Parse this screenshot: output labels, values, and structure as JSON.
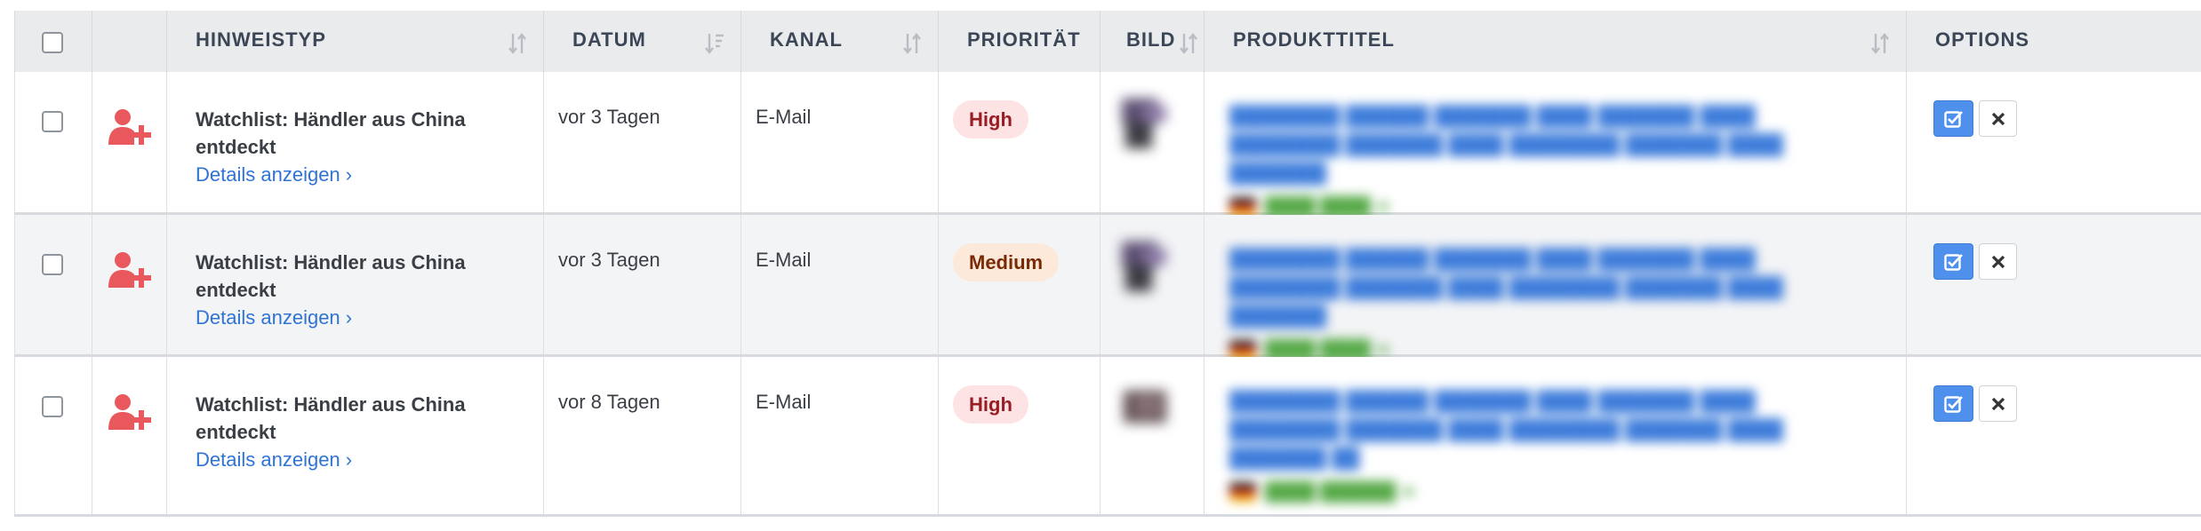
{
  "table": {
    "headers": {
      "type": "HINWEISTYP",
      "date": "DATUM",
      "channel": "KANAL",
      "priority": "PRIORITÄT",
      "image": "BILD",
      "title": "PRODUKTTITEL",
      "options": "OPTIONS"
    },
    "rows": [
      {
        "type": "Watchlist: Händler aus China entdeckt",
        "details": "Details anzeigen ›",
        "date": "vor 3 Tagen",
        "channel": "E-Mail",
        "priority": "High",
        "priority_level": "high",
        "product_title_redacted": "████████ ██████ ███████ ████ ███████ ████ ████████ ███████ ████ ████████ ███████ ████ ███████",
        "meta_redacted": "████ ████ ★"
      },
      {
        "type": "Watchlist: Händler aus China entdeckt",
        "details": "Details anzeigen ›",
        "date": "vor 3 Tagen",
        "channel": "E-Mail",
        "priority": "Medium",
        "priority_level": "medium",
        "product_title_redacted": "████████ ██████ ███████ ████ ███████ ████ ████████ ███████ ████ ████████ ███████ ████ ███████",
        "meta_redacted": "████ ████ ★"
      },
      {
        "type": "Watchlist: Händler aus China entdeckt",
        "details": "Details anzeigen ›",
        "date": "vor 8 Tagen",
        "channel": "E-Mail",
        "priority": "High",
        "priority_level": "high",
        "product_title_redacted": "████████ ██████ ███████ ████ ███████ ████ ████████ ███████ ████ ████████ ███████ ████ ███████ ██",
        "meta_redacted": "████ ██████ ★"
      }
    ]
  },
  "colors": {
    "header_bg": "#eaebed",
    "link": "#2f73d4",
    "alert_icon": "#e8585c",
    "confirm_button": "#4f90ec",
    "badge_high_bg": "#fde3e4",
    "badge_medium_bg": "#fde9da"
  },
  "icons": {
    "row_type": "user-plus-icon",
    "sort": "sort-icon",
    "confirm": "check-square-icon",
    "dismiss": "close-icon"
  }
}
